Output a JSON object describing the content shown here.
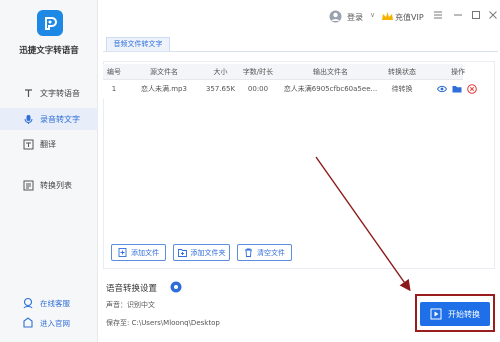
{
  "app": {
    "title": "迅捷文字转语音"
  },
  "sidebar": {
    "items": [
      {
        "label": "文字转语音",
        "icon": "text-to-speech-icon",
        "active": false
      },
      {
        "label": "录音转文字",
        "icon": "microphone-icon",
        "active": true
      },
      {
        "label": "翻译",
        "icon": "translate-icon",
        "active": false
      },
      {
        "label": "转换列表",
        "icon": "list-icon",
        "active": false
      }
    ],
    "bottom": [
      {
        "label": "在线客服",
        "icon": "customer-service-icon"
      },
      {
        "label": "进入官网",
        "icon": "website-icon"
      }
    ]
  },
  "topbar": {
    "login": "登录",
    "vip": "充值VIP"
  },
  "tab": {
    "label": "音频文件转文字"
  },
  "table": {
    "headers": [
      "编号",
      "源文件名",
      "大小",
      "字数/时长",
      "输出文件名",
      "转换状态",
      "操作"
    ],
    "rows": [
      {
        "no": "1",
        "source": "恋人未满.mp3",
        "size": "357.65K",
        "duration": "00:00",
        "output": "恋人未满6905cfbc60a5ee...",
        "status": "待转换"
      }
    ]
  },
  "buttons": {
    "add_file": "添加文件",
    "add_folder": "添加文件夹",
    "clear": "清空文件"
  },
  "settings": {
    "title": "语音转换设置",
    "voice_label": "声音：识别中文",
    "save_label": "保存至: C:\\Users\\Mloonq\\Desktop"
  },
  "start": {
    "label": "开始转换"
  },
  "colors": {
    "accent": "#1e6fe8",
    "highlight": "#9b1c1c"
  }
}
